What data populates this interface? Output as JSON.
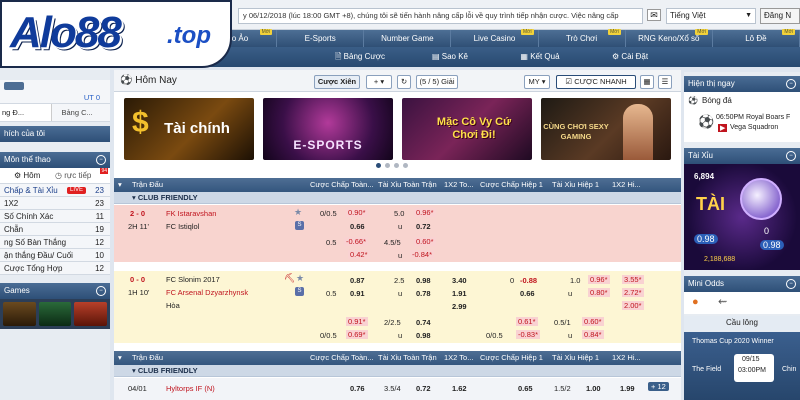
{
  "logo": {
    "brand": "Alo88",
    "tld": ".top"
  },
  "ticker": "y 06/12/2018 (lúc 18:00 GMT +8), chúng tôi sẽ tiến hành nâng cấp lỗi về quy trình tiếp nhận cược. Việc nâng cấp",
  "language": "Tiếng Việt",
  "login_label": "Đăng N",
  "nav": [
    {
      "label": "Thao Ảo",
      "badge": "Mới"
    },
    {
      "label": "E-Sports",
      "badge": ""
    },
    {
      "label": "Number Game",
      "badge": ""
    },
    {
      "label": "Live Casino",
      "badge": "Mới"
    },
    {
      "label": "Trò Chơi",
      "badge": "Mới"
    },
    {
      "label": "RNG Keno/Xổ số",
      "badge": "Mới"
    },
    {
      "label": "Lô Đề",
      "badge": "Mới"
    }
  ],
  "subnav": [
    "Bảng Cược",
    "Sao Kê",
    "Kết Quả",
    "Cài Đặt"
  ],
  "left": {
    "balance": "UT 0",
    "tabs": [
      "ng Đ...",
      "Bảng C..."
    ],
    "account_link": "hích của tôi",
    "sports_header": "Môn thể thao",
    "sub_tabs": [
      "Hôm",
      "rực tiếp"
    ],
    "sub_tab_count": "94",
    "items": [
      {
        "label": "Chấp & Tài Xỉu",
        "count": "23",
        "live": true
      },
      {
        "label": "1X2",
        "count": "23",
        "live": false
      },
      {
        "label": "Số Chính Xác",
        "count": "11",
        "live": false
      },
      {
        "label": "Chẵn",
        "count": "19",
        "live": false
      },
      {
        "label": "ng Số Bàn Thắng",
        "count": "12",
        "live": false
      },
      {
        "label": "ận thắng Đầu/ Cuối",
        "count": "10",
        "live": false
      },
      {
        "label": "Cược Tổng Hợp",
        "count": "12",
        "live": false
      }
    ],
    "games_header": "Games",
    "live_label": "LIVE",
    "live_count": "14"
  },
  "main": {
    "title": "Hôm Nay",
    "btn_parlay": "Cược Xiên",
    "btn_plus": "+",
    "btn_refresh": "↻",
    "btn_pages": "(5 / 5) Giải",
    "btn_sort": "MY",
    "btn_fast": "CƯỢC NHANH",
    "banners": [
      "Tài chính",
      "E-SPORTS",
      "Mặc Cô Vy Cứ Chơi Đi!",
      "CÙNG CHƠI SEXY GAMING"
    ],
    "headers": [
      "Trận Đấu",
      "Cược Chấp Toàn...",
      "Tài Xỉu Toàn Trận",
      "1X2 To...",
      "Cược Chấp Hiệp 1",
      "Tài Xỉu Hiệp 1",
      "1X2 Hi..."
    ],
    "league": "CLUB FRIENDLY",
    "match1": {
      "score": "2 - 0",
      "time": "2H 11'",
      "home": "FK Istaravshan",
      "away": "FC Istiqlol",
      "r1": {
        "hcp": "0/0.5",
        "h1": "0.90*",
        "ou": "5.0",
        "o1": "0.96*"
      },
      "r2": {
        "h2": "0.66",
        "o2": "0.72",
        "u": "u"
      },
      "r3": {
        "hcp": "0.5",
        "h1": "-0.66*",
        "ou": "4.5/5",
        "o1": "0.60*"
      },
      "r4": {
        "h2": "0.42*",
        "o2": "-0.84*",
        "u": "u"
      }
    },
    "match2": {
      "score": "0 - 0",
      "time": "1H 10'",
      "home": "FC Slonim 2017",
      "away": "FC Arsenal Dzyarzhynsk",
      "draw": "Hòa",
      "r1": {
        "h1": "0.87",
        "ou": "2.5",
        "o1": "0.98",
        "x1": "3.40",
        "hh": "0",
        "hh1": "-0.88",
        "ou1": "1.0",
        "hou1": "0.96*",
        "hx": "3.55*"
      },
      "r2": {
        "hcp": "0.5",
        "h2": "0.91",
        "u": "u",
        "o2": "0.78",
        "x2": "1.91",
        "hh2": "0.66",
        "hu": "u",
        "hou2": "0.80*",
        "hx2": "2.72*"
      },
      "r3": {
        "x3": "2.99",
        "hx3": "2.00*"
      },
      "r4": {
        "h1": "0.91*",
        "ou": "2/2.5",
        "o1": "0.74",
        "hh1": "0.61*",
        "hou": "0.5/1",
        "ho1": "0.60*"
      },
      "r5": {
        "hcp": "0/0.5",
        "h2": "0.69*",
        "u": "u",
        "o2": "0.98",
        "hhcp": "0/0.5",
        "hh2": "-0.83*",
        "hu": "u",
        "ho2": "0.84*"
      }
    },
    "match3": {
      "time": "04/01",
      "home": "Hyltorps IF (N)",
      "h": "0.76",
      "ou": "3.5/4",
      "o": "0.72",
      "x": "1.62",
      "hh": "0.65",
      "hou": "1.5/2",
      "ho": "1.00",
      "hx": "1.99",
      "more": "+ 12"
    }
  },
  "right": {
    "display_header": "Hiện thị ngay",
    "sport": "Bóng đá",
    "event_time": "06:50PM Royal Boars F",
    "event_team": "Vega Squadron",
    "taixiu_header": "Tài Xỉu",
    "taixiu": {
      "left_num": "6,894",
      "left_word": "TÀI",
      "left_ratio": "0.98",
      "right_num": "0",
      "right_ratio": "0.98",
      "chip": "2,188,688"
    },
    "odds_header": "Mini Odds",
    "odds_sport": "Cầu lông",
    "odds_event": "Thomas Cup 2020 Winner",
    "odds_left": "The Field",
    "odds_right": "Chin",
    "odds_date": "09/15",
    "odds_time": "03:00PM"
  },
  "colors": {
    "nav": "#2f4f75",
    "league": "#cdd8e6",
    "pink": "#f8d4cf",
    "yellow": "#fdf6d4",
    "odd_red": "#c0141e"
  }
}
